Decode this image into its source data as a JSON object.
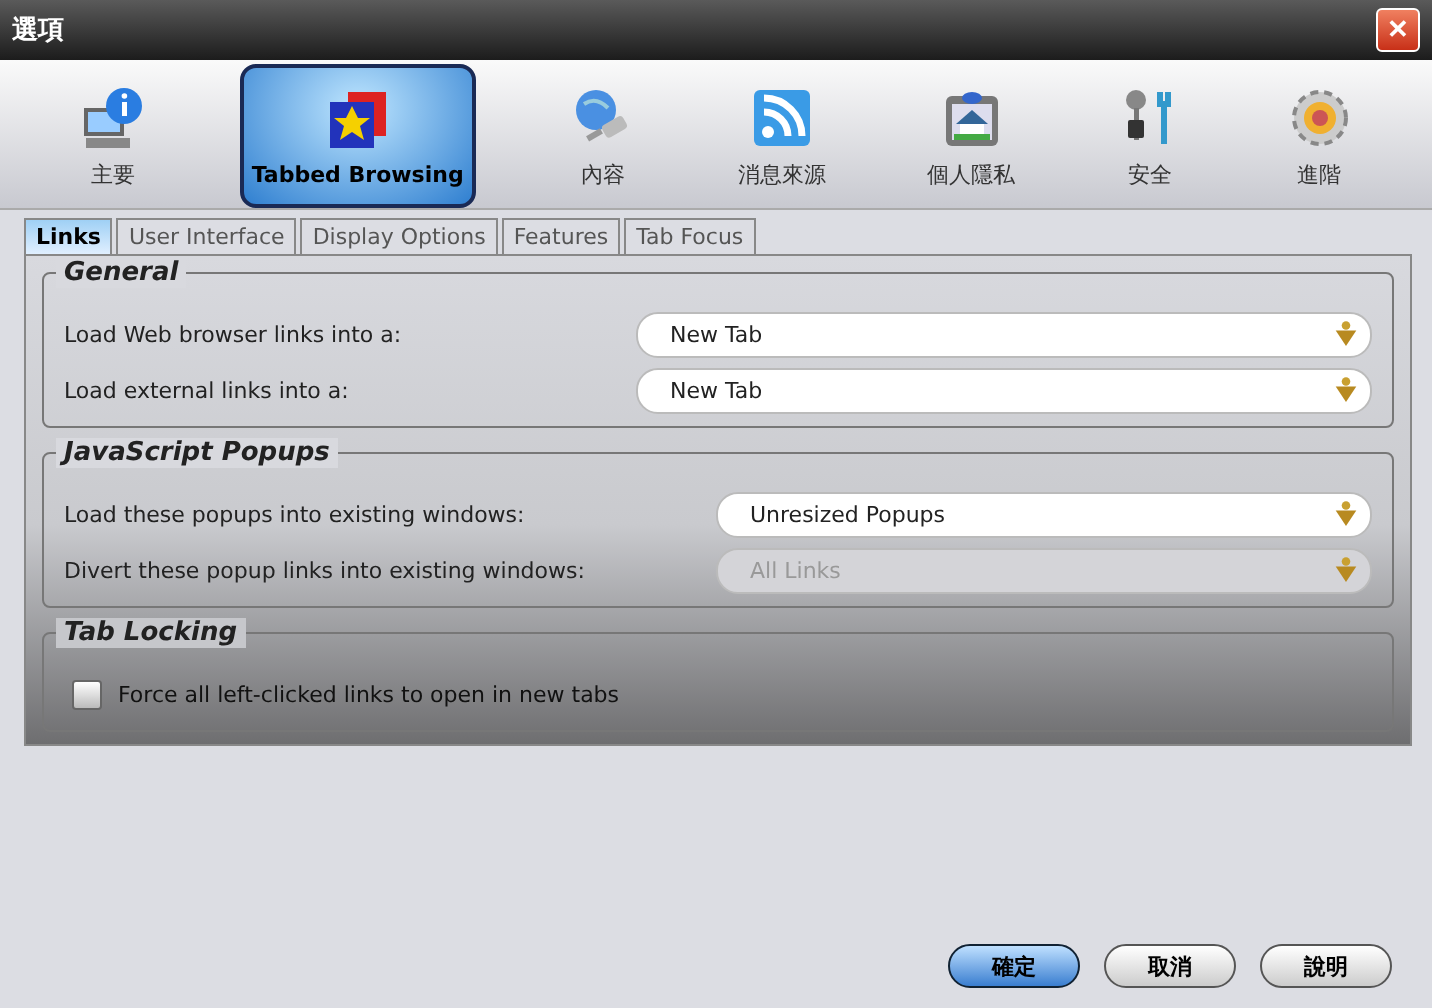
{
  "window": {
    "title": "選項",
    "close": "✕"
  },
  "categories": [
    {
      "label": "主要",
      "selected": false
    },
    {
      "label": "Tabbed Browsing",
      "selected": true
    },
    {
      "label": "內容",
      "selected": false
    },
    {
      "label": "消息來源",
      "selected": false
    },
    {
      "label": "個人隱私",
      "selected": false
    },
    {
      "label": "安全",
      "selected": false
    },
    {
      "label": "進階",
      "selected": false
    }
  ],
  "tabs": [
    {
      "label": "Links",
      "selected": true
    },
    {
      "label": "User Interface",
      "selected": false
    },
    {
      "label": "Display Options",
      "selected": false
    },
    {
      "label": "Features",
      "selected": false
    },
    {
      "label": "Tab Focus",
      "selected": false
    }
  ],
  "sections": [
    {
      "title": "General",
      "rows": [
        {
          "kind": "dropdown",
          "label": "Load Web browser links into a:",
          "value": "New Tab",
          "disabled": false
        },
        {
          "kind": "dropdown",
          "label": "Load external links into a:",
          "value": "New Tab",
          "disabled": false
        }
      ]
    },
    {
      "title": "JavaScript Popups",
      "rows": [
        {
          "kind": "dropdown",
          "label": "Load these popups into existing windows:",
          "value": "Unresized Popups",
          "disabled": false
        },
        {
          "kind": "dropdown",
          "label": "Divert these popup links into existing windows:",
          "value": "All Links",
          "disabled": true
        }
      ]
    },
    {
      "title": "Tab Locking",
      "rows": [
        {
          "kind": "checkbox",
          "label": "Force all left-clicked links to open in new tabs",
          "checked": false
        }
      ]
    }
  ],
  "buttons": [
    {
      "label": "確定",
      "default": true
    },
    {
      "label": "取消",
      "default": false
    },
    {
      "label": "說明",
      "default": false
    }
  ]
}
